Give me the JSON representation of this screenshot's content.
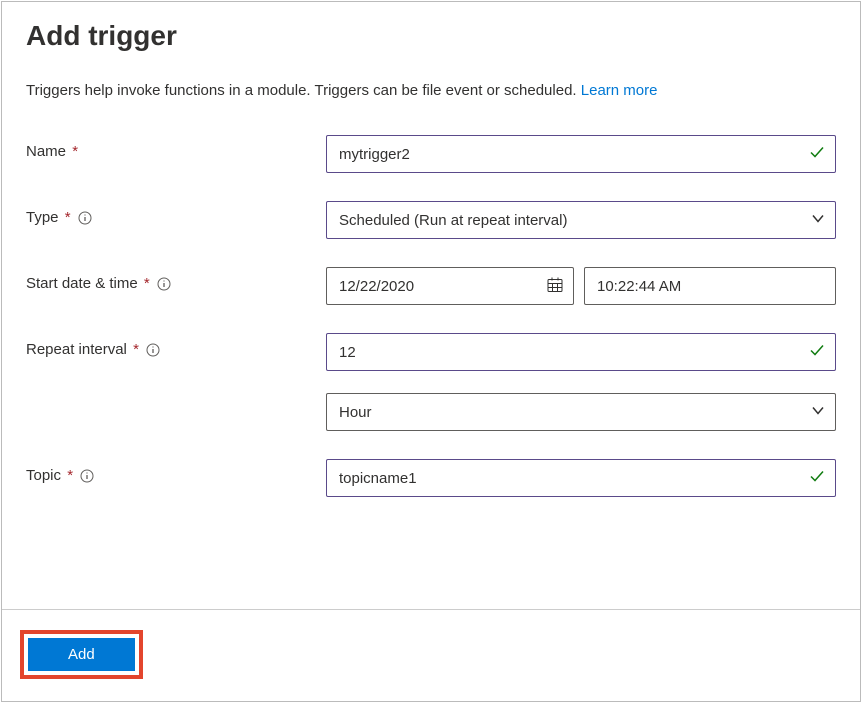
{
  "header": {
    "title": "Add trigger"
  },
  "description": {
    "text": "Triggers help invoke functions in a module. Triggers can be file event or scheduled. ",
    "learn_more": "Learn more"
  },
  "fields": {
    "name": {
      "label": "Name",
      "value": "mytrigger2"
    },
    "type": {
      "label": "Type",
      "value": "Scheduled (Run at repeat interval)"
    },
    "start_datetime": {
      "label": "Start date & time",
      "date": "12/22/2020",
      "time": "10:22:44 AM"
    },
    "repeat_interval": {
      "label": "Repeat interval",
      "value": "12",
      "unit": "Hour"
    },
    "topic": {
      "label": "Topic",
      "value": "topicname1"
    }
  },
  "footer": {
    "add_label": "Add"
  }
}
